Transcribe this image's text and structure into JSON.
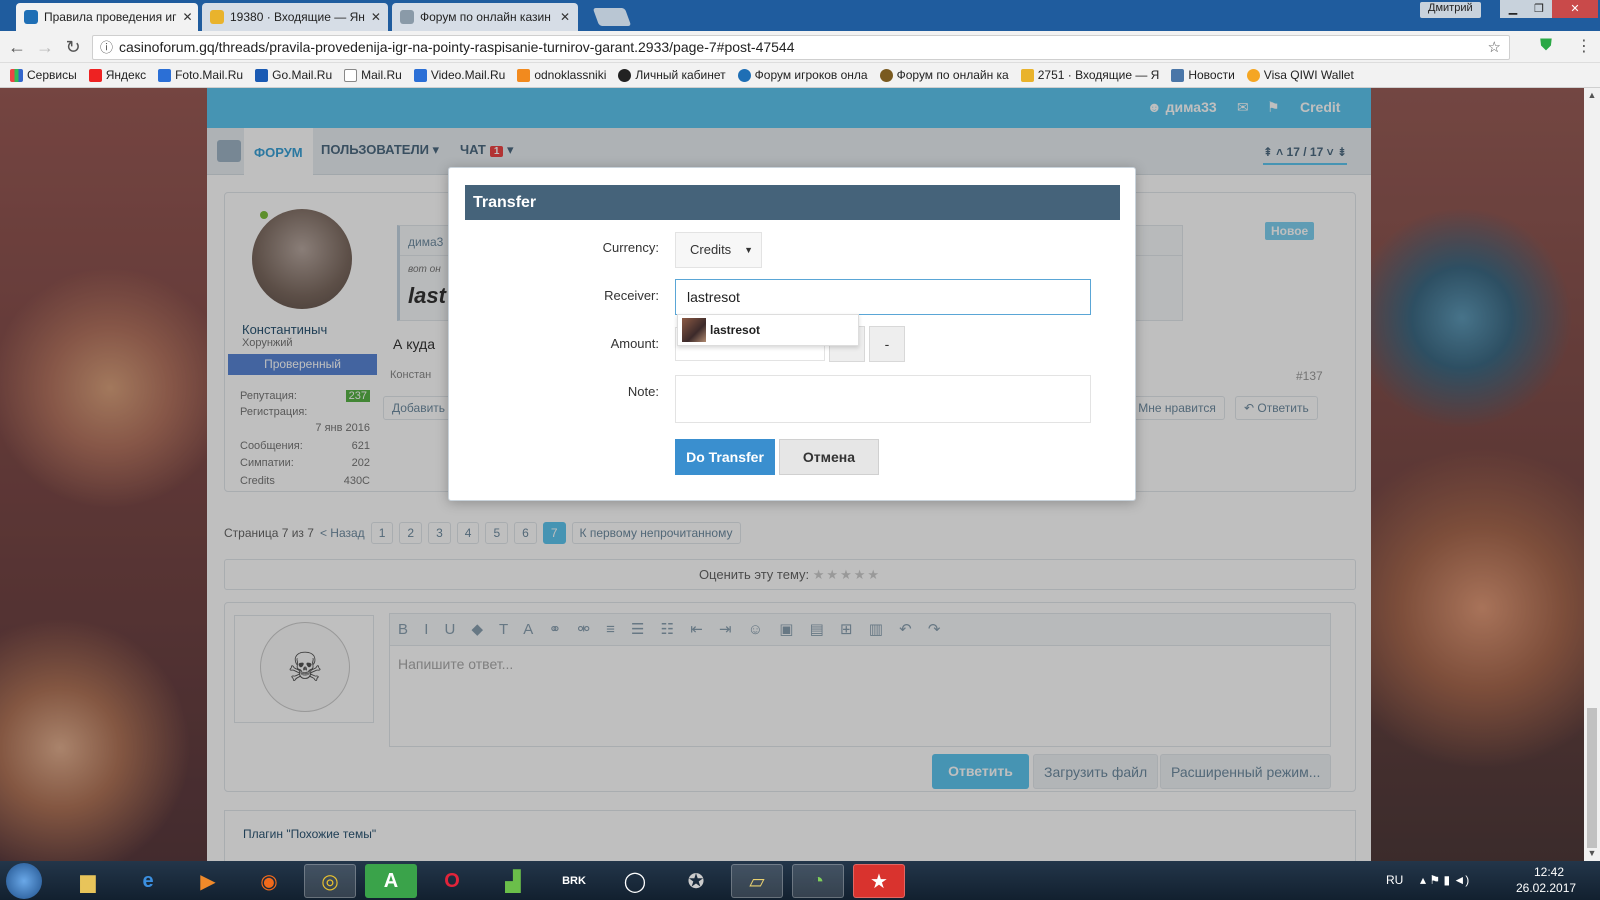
{
  "browser": {
    "tabs": [
      {
        "title": "Правила проведения иг",
        "active": true
      },
      {
        "title": "19380 · Входящие — Ян",
        "active": false
      },
      {
        "title": "Форум по онлайн казин",
        "active": false
      }
    ],
    "user": "Дмитрий",
    "url": "casinoforum.gq/threads/pravila-provedenija-igr-na-pointy-raspisanie-turnirov-garant.2933/page-7#post-47544",
    "bookmarks": [
      "Сервисы",
      "Яндекс",
      "Foto.Mail.Ru",
      "Go.Mail.Ru",
      "Mail.Ru",
      "Video.Mail.Ru",
      "odnoklassniki",
      "Личный кабинет",
      "Форум игроков онла",
      "Форум по онлайн ка",
      "2751 · Входящие — Я",
      "Новости",
      "Visa QIWI Wallet"
    ]
  },
  "site": {
    "header": {
      "username": "дима33",
      "credit_label": "Credit"
    },
    "nav": {
      "forum": "ФОРУМ",
      "users": "ПОЛЬЗОВАТЕЛИ",
      "chat": "ЧАТ",
      "chat_badge": "1",
      "page_nav": "17 / 17"
    },
    "post": {
      "author": "Константиныч",
      "rank": "Хорунжий",
      "verified": "Проверенный",
      "stats": [
        {
          "label": "Репутация:",
          "value": "237"
        },
        {
          "label": "Регистрация:",
          "value": ""
        },
        {
          "label": "",
          "value": "7 янв 2016"
        },
        {
          "label": "Сообщения:",
          "value": "621"
        },
        {
          "label": "Симпатии:",
          "value": "202"
        },
        {
          "label": "Credits",
          "value": "430C"
        }
      ],
      "quote_author": "дима3",
      "quote_meta": "вот он",
      "quote_text": "last",
      "message": "А куда",
      "footer_author": "Констан",
      "new_badge": "Новое",
      "post_number": "#137",
      "add_button": "Добавить",
      "like_button": "Мне нравится",
      "reply_button": "Ответить"
    },
    "pager": {
      "label": "Страница 7 из 7",
      "back": "< Назад",
      "pages": [
        "1",
        "2",
        "3",
        "4",
        "5",
        "6",
        "7"
      ],
      "current": "7",
      "first_unread": "К первому непрочитанному"
    },
    "rating": {
      "label": "Оценить эту тему:",
      "stars": "★★★★★"
    },
    "reply": {
      "placeholder": "Напишите ответ...",
      "submit": "Ответить",
      "upload": "Загрузить файл",
      "advanced": "Расширенный режим..."
    },
    "similar": "Плагин \"Похожие темы\""
  },
  "modal": {
    "title": "Transfer",
    "currency_label": "Currency:",
    "currency_value": "Credits",
    "receiver_label": "Receiver:",
    "receiver_value": "lastresot",
    "suggestion": "lastresot",
    "amount_label": "Amount:",
    "minus": "-",
    "note_label": "Note:",
    "submit": "Do Transfer",
    "cancel": "Отмена"
  },
  "taskbar": {
    "lang": "RU",
    "time": "12:42",
    "date": "26.02.2017"
  }
}
